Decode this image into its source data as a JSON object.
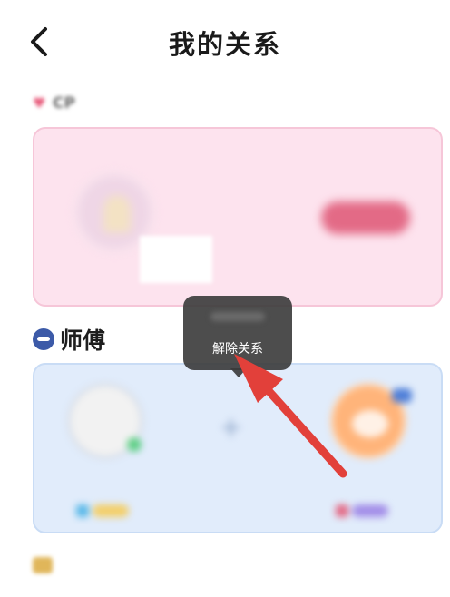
{
  "header": {
    "title": "我的关系",
    "back_icon": "chevron-left-icon"
  },
  "cp_section": {
    "label": "CP",
    "icon": "heart-icon",
    "invite_text": "",
    "invite_button": "",
    "colors": {
      "card_bg": "#fde3ee",
      "button": "#e36a86"
    }
  },
  "master_section": {
    "label": "师傅",
    "icon": "mustache-icon",
    "members": [
      {
        "name": "",
        "avatar": "avatar-blank"
      },
      {
        "name": "",
        "avatar": "add-slot"
      },
      {
        "name": "",
        "avatar": "avatar-cartoon"
      }
    ],
    "colors": {
      "card_bg": "#e1ecfb",
      "icon": "#3c5aa8"
    }
  },
  "third_section": {
    "label": "",
    "icon": "crown-icon"
  },
  "popup": {
    "action_label": "解除关系"
  },
  "annotation": {
    "arrow_color": "#e2403a"
  }
}
